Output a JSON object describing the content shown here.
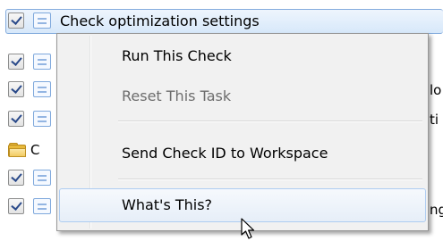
{
  "tree": {
    "selected_row": {
      "label": "Check optimization settings"
    },
    "folder_row": {
      "label_fragment": "C"
    },
    "text_fragments": [
      "lo",
      "ti",
      "ng"
    ]
  },
  "context_menu": {
    "items": [
      {
        "label": "Run This Check",
        "enabled": true
      },
      {
        "label": "Reset This Task",
        "enabled": false
      },
      {
        "label": "Send Check ID to Workspace",
        "enabled": true
      },
      {
        "label": "What's This?",
        "enabled": true,
        "highlighted": true
      }
    ]
  },
  "colors": {
    "selection_bg": "#d7e8fa",
    "selection_border": "#84acdd",
    "menu_bg": "#f1f1f1",
    "disabled_text": "#6d6d6d",
    "hover_border": "#aeccf1"
  },
  "icons": [
    "checkbox-checked-icon",
    "check-item-icon",
    "folder-icon",
    "mouse-pointer-icon"
  ]
}
